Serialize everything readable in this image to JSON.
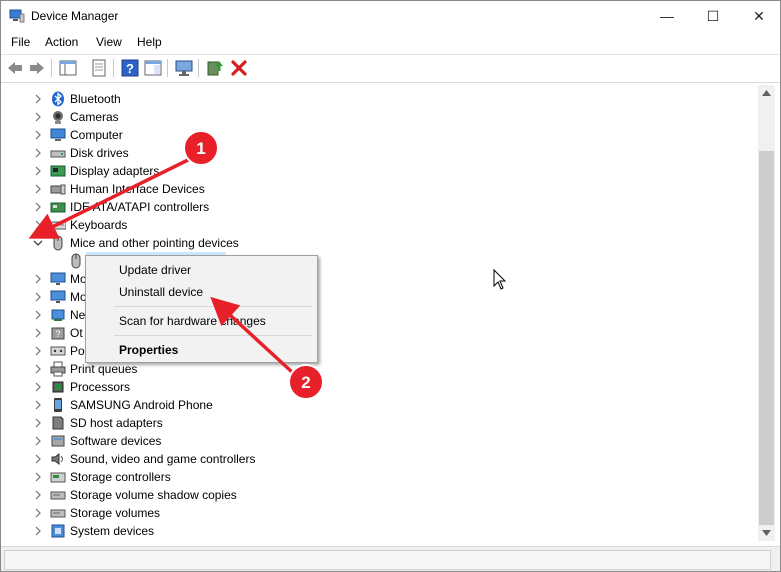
{
  "window": {
    "title": "Device Manager",
    "controls": {
      "minimize": "—",
      "maximize": "☐",
      "close": "✕"
    }
  },
  "menu": [
    "File",
    "Action",
    "View",
    "Help"
  ],
  "tree": [
    {
      "label": "Bluetooth",
      "icon": "bluetooth-icon"
    },
    {
      "label": "Cameras",
      "icon": "camera-icon"
    },
    {
      "label": "Computer",
      "icon": "computer-icon"
    },
    {
      "label": "Disk drives",
      "icon": "disk-drive-icon"
    },
    {
      "label": "Display adapters",
      "icon": "display-adapter-icon"
    },
    {
      "label": "Human Interface Devices",
      "icon": "hid-icon"
    },
    {
      "label": "IDE ATA/ATAPI controllers",
      "icon": "ide-controller-icon"
    },
    {
      "label": "Keyboards",
      "icon": "keyboard-icon"
    },
    {
      "label": "Mice and other pointing devices",
      "icon": "mouse-icon",
      "expanded": true
    },
    {
      "label": "",
      "icon": "mouse-icon",
      "child": true,
      "selected": true
    },
    {
      "label": "Mo",
      "icon": "monitor-icon"
    },
    {
      "label": "Mo",
      "icon": "monitor-icon"
    },
    {
      "label": "Ne",
      "icon": "network-adapter-icon"
    },
    {
      "label": "Ot",
      "icon": "other-devices-icon"
    },
    {
      "label": "Po",
      "icon": "ports-icon"
    },
    {
      "label": "Print queues",
      "icon": "printer-icon"
    },
    {
      "label": "Processors",
      "icon": "processor-icon"
    },
    {
      "label": "SAMSUNG Android Phone",
      "icon": "phone-icon"
    },
    {
      "label": "SD host adapters",
      "icon": "sd-adapter-icon"
    },
    {
      "label": "Software devices",
      "icon": "software-device-icon"
    },
    {
      "label": "Sound, video and game controllers",
      "icon": "sound-icon"
    },
    {
      "label": "Storage controllers",
      "icon": "storage-controller-icon"
    },
    {
      "label": "Storage volume shadow copies",
      "icon": "storage-icon"
    },
    {
      "label": "Storage volumes",
      "icon": "storage-icon"
    },
    {
      "label": "System devices",
      "icon": "system-device-icon"
    }
  ],
  "context_menu": {
    "update": "Update driver",
    "uninstall": "Uninstall device",
    "scan": "Scan for hardware changes",
    "properties": "Properties"
  },
  "annotations": {
    "badge1": "1",
    "badge2": "2",
    "color": "#e8202a"
  }
}
